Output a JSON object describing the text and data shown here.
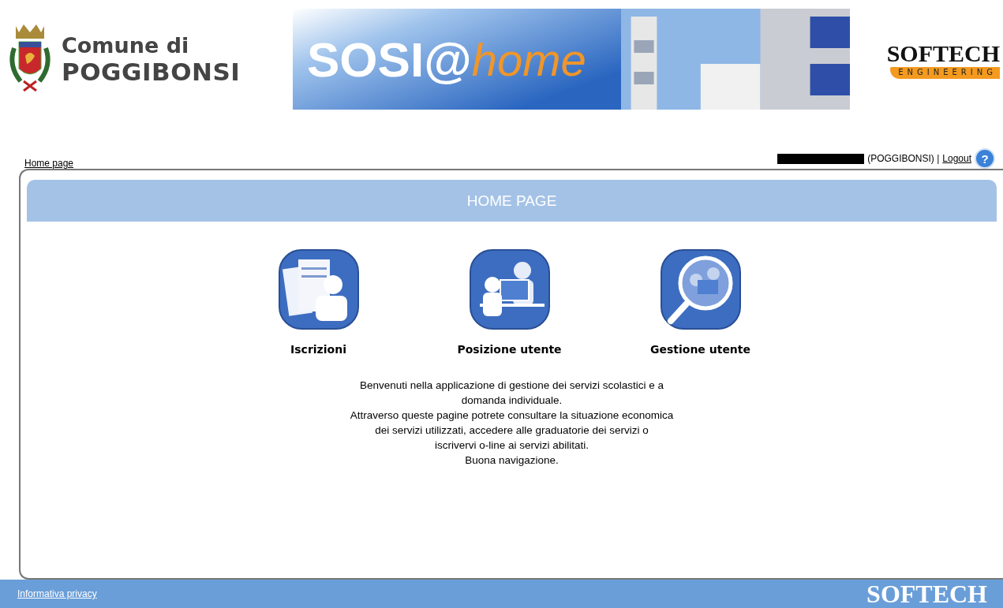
{
  "header": {
    "municipality": {
      "line1": "Comune di",
      "line2": "POGGIBONSI"
    },
    "banner": {
      "part1": "SOSI",
      "at": "@",
      "part2": "home"
    },
    "vendor": {
      "name": "SOFTECH",
      "tagline": "ENGINEERING"
    }
  },
  "nav": {
    "home_link": "Home page",
    "user": "(POGGIBONSI) |",
    "logout": "Logout",
    "help": "?"
  },
  "panel": {
    "title": "HOME PAGE",
    "menu": [
      {
        "kind": "enrollment",
        "label": "Iscrizioni"
      },
      {
        "kind": "position",
        "label": "Posizione utente"
      },
      {
        "kind": "management",
        "label": "Gestione utente"
      }
    ],
    "welcome": [
      "Benvenuti nella applicazione di gestione dei servizi scolastici e a",
      "domanda individuale.",
      "Attraverso queste pagine potrete consultare la situazione economica",
      "dei servizi utilizzati, accedere alle graduatorie dei servizi o",
      "iscrivervi o-line ai servizi abilitati.",
      "Buona navigazione."
    ]
  },
  "footer": {
    "privacy": "Informativa privacy",
    "brand": "SOFTECH"
  }
}
